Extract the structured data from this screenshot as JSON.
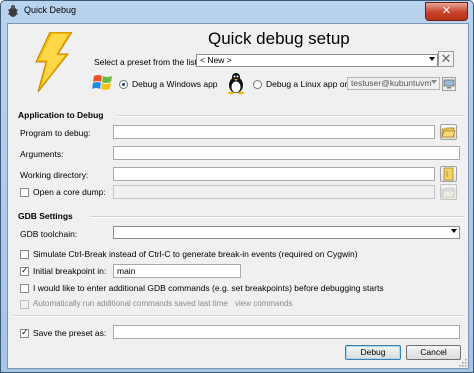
{
  "window": {
    "title": "Quick Debug",
    "close_glyph": "✕"
  },
  "header": {
    "title": "Quick debug setup",
    "preset_label": "Select a preset from the list:",
    "preset_value": "< New >",
    "delete_glyph": "✕",
    "windows_option": "Debug a Windows app",
    "linux_option": "Debug a Linux app on",
    "linux_host": "testuser@kubuntuvm"
  },
  "app": {
    "group_title": "Application to Debug",
    "program_label": "Program to debug:",
    "program_value": "",
    "arguments_label": "Arguments:",
    "arguments_value": "",
    "workdir_label": "Working directory:",
    "workdir_value": "",
    "core_dump_label": "Open a core dump:",
    "core_dump_value": ""
  },
  "gdb": {
    "group_title": "GDB Settings",
    "toolchain_label": "GDB toolchain:",
    "toolchain_value": "",
    "ctrl_break_label": "Simulate Ctrl-Break instead of Ctrl-C to generate break-in events (required on Cygwin)",
    "initial_bp_label": "Initial breakpoint in:",
    "initial_bp_value": "main",
    "extra_cmds_label": "I would like to enter additional GDB commands (e.g. set breakpoints) before debugging starts",
    "auto_run_label": "Automatically run additional commands saved last time",
    "view_commands": "view commands"
  },
  "footer": {
    "save_preset_label": "Save the preset as:",
    "save_preset_value": "",
    "debug_button": "Debug",
    "cancel_button": "Cancel"
  },
  "state": {
    "windows_selected": true,
    "ctrl_break": false,
    "initial_bp": true,
    "extra_cmds": false,
    "auto_run": false,
    "save_preset": true,
    "core_dump": false
  },
  "colors": {
    "accent": "#3c7fb1",
    "bolt": "#f5b800",
    "close": "#c8432a"
  }
}
